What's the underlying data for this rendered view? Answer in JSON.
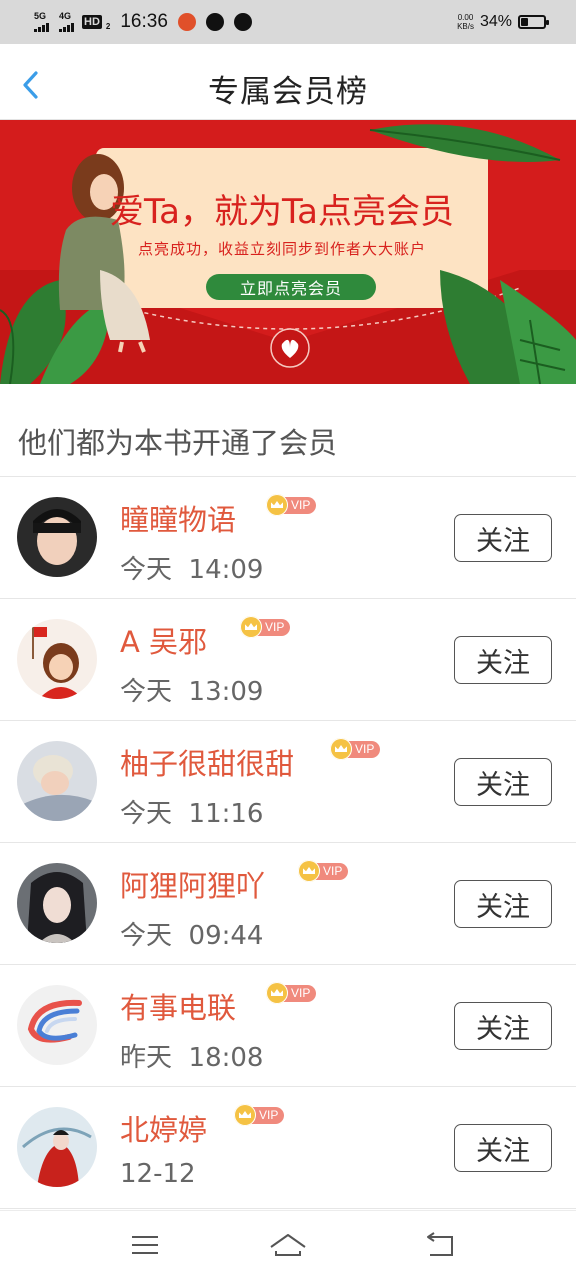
{
  "status_bar": {
    "net1": "5G",
    "net2": "4G",
    "hd": "HD",
    "hd_sub": "2",
    "time": "16:36",
    "speed_value": "0.00",
    "speed_unit": "KB/s",
    "battery_pct": "34%",
    "battery_level": 0.34
  },
  "header": {
    "title": "专属会员榜"
  },
  "banner": {
    "headline": "爱Ta，就为Ta点亮会员",
    "subline": "点亮成功，收益立刻同步到作者大大账户",
    "cta": "立即点亮会员",
    "colors": {
      "bg": "#d41c1c",
      "card": "#fde3c3",
      "cta": "#2f8a3c",
      "leaf": "#2e7d32"
    }
  },
  "section": {
    "title": "他们都为本书开通了会员"
  },
  "members": [
    {
      "name": "瞳瞳物语",
      "badge": "VIP",
      "day": "今天",
      "time": "14:09",
      "follow": "关注"
    },
    {
      "name": "A 吴邪",
      "badge": "VIP",
      "day": "今天",
      "time": "13:09",
      "follow": "关注"
    },
    {
      "name": "柚子很甜很甜",
      "badge": "VIP",
      "day": "今天",
      "time": "11:16",
      "follow": "关注"
    },
    {
      "name": "阿狸阿狸吖",
      "badge": "VIP",
      "day": "今天",
      "time": "09:44",
      "follow": "关注"
    },
    {
      "name": "有事电联",
      "badge": "VIP",
      "day": "昨天",
      "time": "18:08",
      "follow": "关注"
    },
    {
      "name": "北婷婷",
      "badge": "VIP",
      "day": "12-12",
      "time": "",
      "follow": "关注"
    }
  ],
  "colors": {
    "name": "#e0593d",
    "vip_badge": "#f08a7d",
    "crown": "#f5c244",
    "back_arrow": "#3b9de8"
  }
}
